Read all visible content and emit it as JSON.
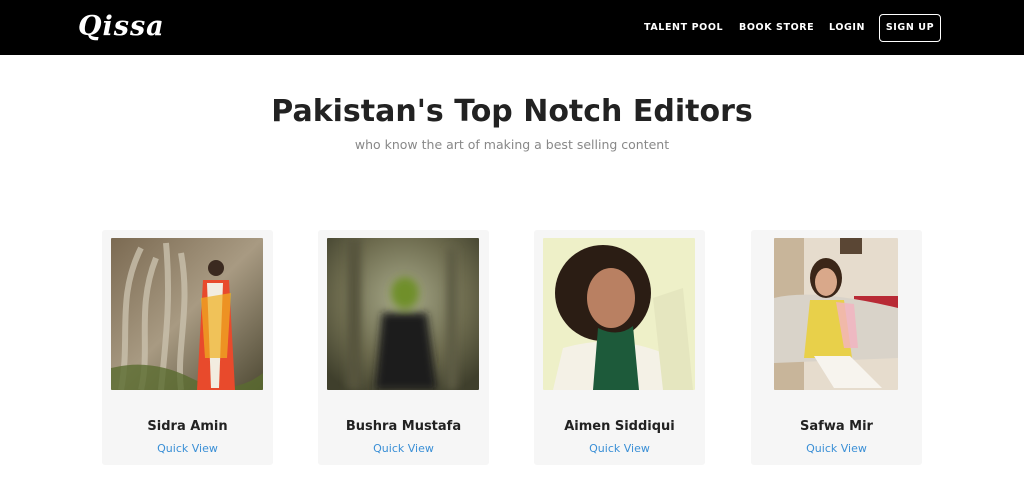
{
  "brand": {
    "logo_text": "Qissa"
  },
  "nav": {
    "items": [
      {
        "label": "TALENT POOL"
      },
      {
        "label": "BOOK STORE"
      },
      {
        "label": "LOGIN"
      }
    ],
    "signup_label": "SIGN UP"
  },
  "hero": {
    "title": "Pakistan's Top Notch Editors",
    "subtitle": "who know the art of making a best selling content"
  },
  "editors": [
    {
      "name": "Sidra Amin",
      "link": "Quick View"
    },
    {
      "name": "Bushra Mustafa",
      "link": "Quick View"
    },
    {
      "name": "Aimen Siddiqui",
      "link": "Quick View"
    },
    {
      "name": "Safwa Mir",
      "link": "Quick View"
    }
  ],
  "colors": {
    "navbar_bg": "#000000",
    "link_blue": "#3a8fd6",
    "card_bg": "#f6f6f6",
    "subtitle_gray": "#888888"
  }
}
